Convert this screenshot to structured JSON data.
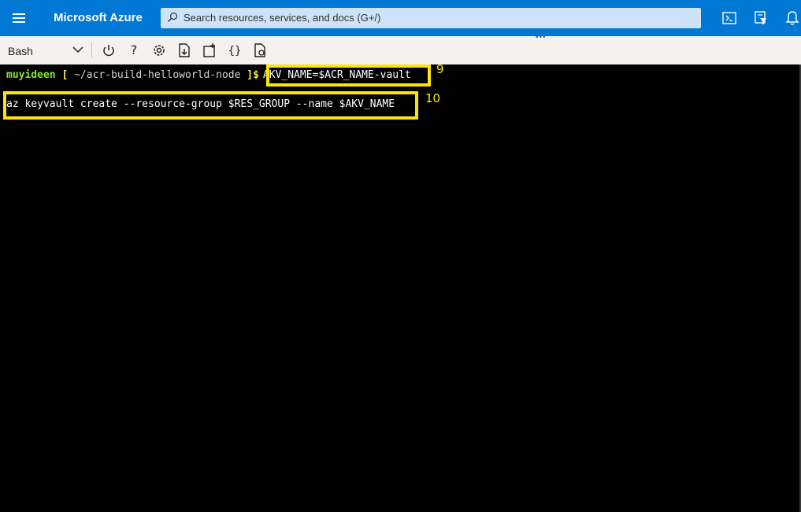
{
  "header": {
    "brand": "Microsoft Azure",
    "search_placeholder": "Search resources, services, and docs (G+/)",
    "icons": [
      "menu-icon",
      "cloud-shell-icon",
      "directory-filter-icon",
      "notifications-icon"
    ]
  },
  "toolbar": {
    "shell": "Bash",
    "icons": [
      "power-icon",
      "help-icon",
      "settings-icon",
      "upload-download-icon",
      "new-session-icon",
      "editor-braces-icon",
      "web-preview-icon"
    ]
  },
  "terminal": {
    "user": "muyideen",
    "bracket_open": "[",
    "path": "~/acr-build-helloworld-node",
    "prompt_close": "]$",
    "command1": "AKV_NAME=$ACR_NAME-vault",
    "command2": "az keyvault create --resource-group $RES_GROUP --name $AKV_NAME"
  },
  "annotations": {
    "label1": "9",
    "label2": "10",
    "color": "#ffe600"
  },
  "colors": {
    "accent": "#0078d4",
    "search_bg": "#cde3f7",
    "toolbar_bg": "#f3f2f1",
    "terminal_bg": "#000000",
    "user_green": "#8ae234",
    "bracket_yellow": "#fce94f"
  }
}
